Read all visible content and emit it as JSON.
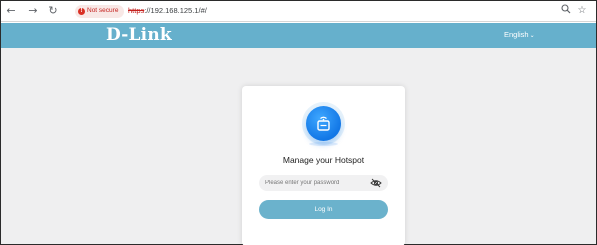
{
  "browser": {
    "back_glyph": "←",
    "forward_glyph": "→",
    "reload_glyph": "↻",
    "security_warning": "Not secure",
    "url_scheme": "https",
    "url_rest": "://192.168.125.1/#/",
    "zoom_glyph": "🔍",
    "bookmark_glyph": "☆"
  },
  "header": {
    "logo": "D-Link",
    "language": "English",
    "language_chevron": "⌄",
    "background_color": "#66b0cc"
  },
  "login": {
    "title": "Manage your Hotspot",
    "password_placeholder": "Please enter your password",
    "password_value": "",
    "login_label": "Log In",
    "icon_color": "#1277e6"
  }
}
